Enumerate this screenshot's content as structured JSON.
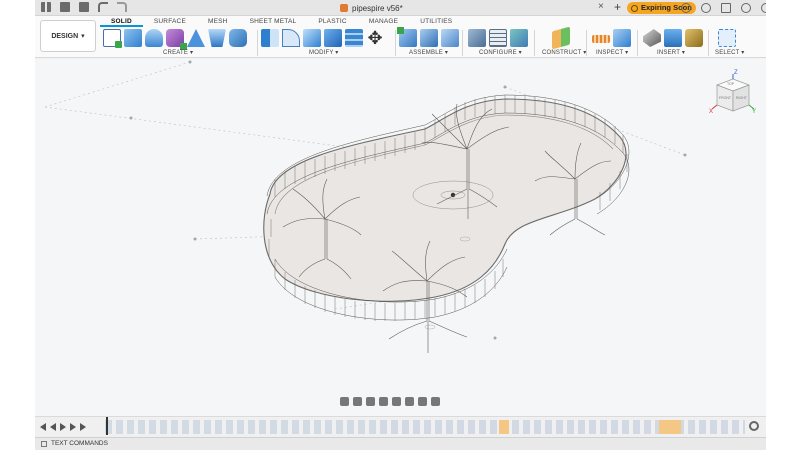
{
  "titlebar": {
    "document_title": "pipespire v56*",
    "expiring_label": "Expiring Soon"
  },
  "ribbon": {
    "workspace_label": "DESIGN",
    "tabs": [
      "SOLID",
      "SURFACE",
      "MESH",
      "SHEET METAL",
      "PLASTIC",
      "MANAGE",
      "UTILITIES"
    ],
    "active_tab": "SOLID",
    "groups": {
      "create": "CREATE ▾",
      "modify": "MODIFY ▾",
      "assemble": "ASSEMBLE ▾",
      "configure": "CONFIGURE ▾",
      "construct": "CONSTRUCT ▾",
      "inspect": "INSPECT ▾",
      "insert": "INSERT ▾",
      "select": "SELECT ▾"
    }
  },
  "viewcube": {
    "axis_z": "Z",
    "axis_x": "X",
    "axis_y": "Y",
    "face_top": "TOP",
    "face_front": "FRONT",
    "face_right": "RIGHT"
  },
  "statusbar": {
    "text_commands": "TEXT COMMANDS"
  },
  "colors": {
    "accent": "#0696d7",
    "expiring": "#f4a521",
    "document_icon": "#e07a2e"
  }
}
